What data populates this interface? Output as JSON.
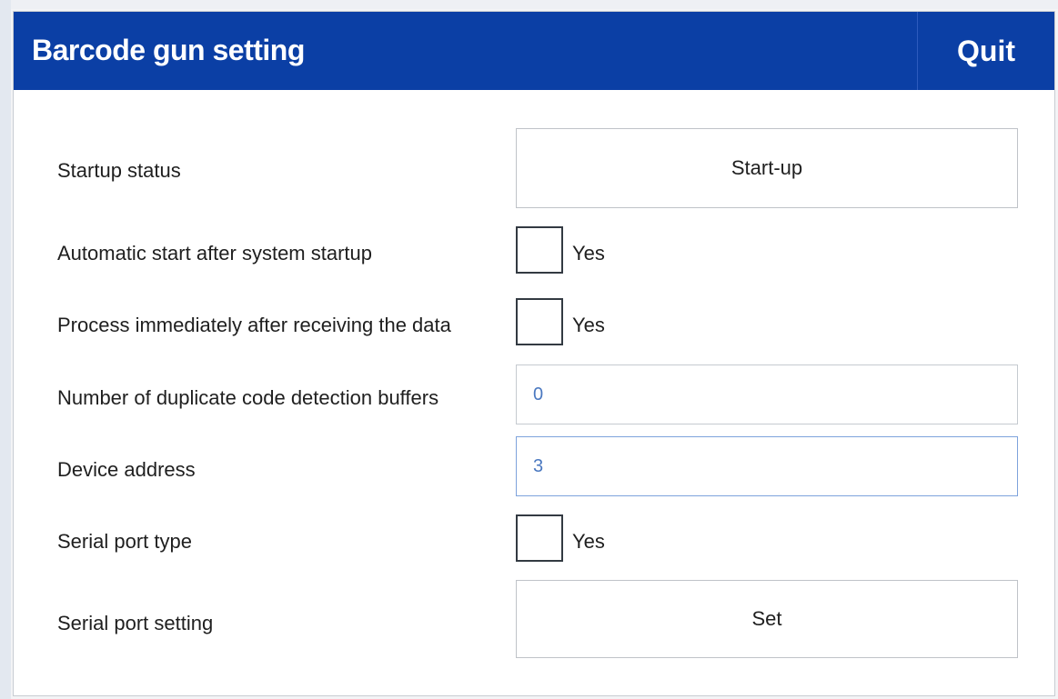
{
  "dialog": {
    "title": "Barcode gun setting",
    "quit_label": "Quit"
  },
  "rows": {
    "startup_status": {
      "label": "Startup status",
      "button": "Start-up"
    },
    "auto_start": {
      "label": "Automatic start after system startup",
      "checkbox_label": "Yes",
      "checked": false
    },
    "process_immediately": {
      "label": "Process immediately after receiving the data",
      "checkbox_label": "Yes",
      "checked": false
    },
    "duplicate_buffers": {
      "label": "Number of duplicate code detection buffers",
      "value": "0"
    },
    "device_address": {
      "label": "Device address",
      "value": "3"
    },
    "serial_port_type": {
      "label": "Serial port type",
      "checkbox_label": "Yes",
      "checked": false
    },
    "serial_port_setting": {
      "label": "Serial port setting",
      "button": "Set"
    }
  },
  "colors": {
    "titlebar": "#0b3fa5",
    "input_text": "#4a78c0"
  }
}
